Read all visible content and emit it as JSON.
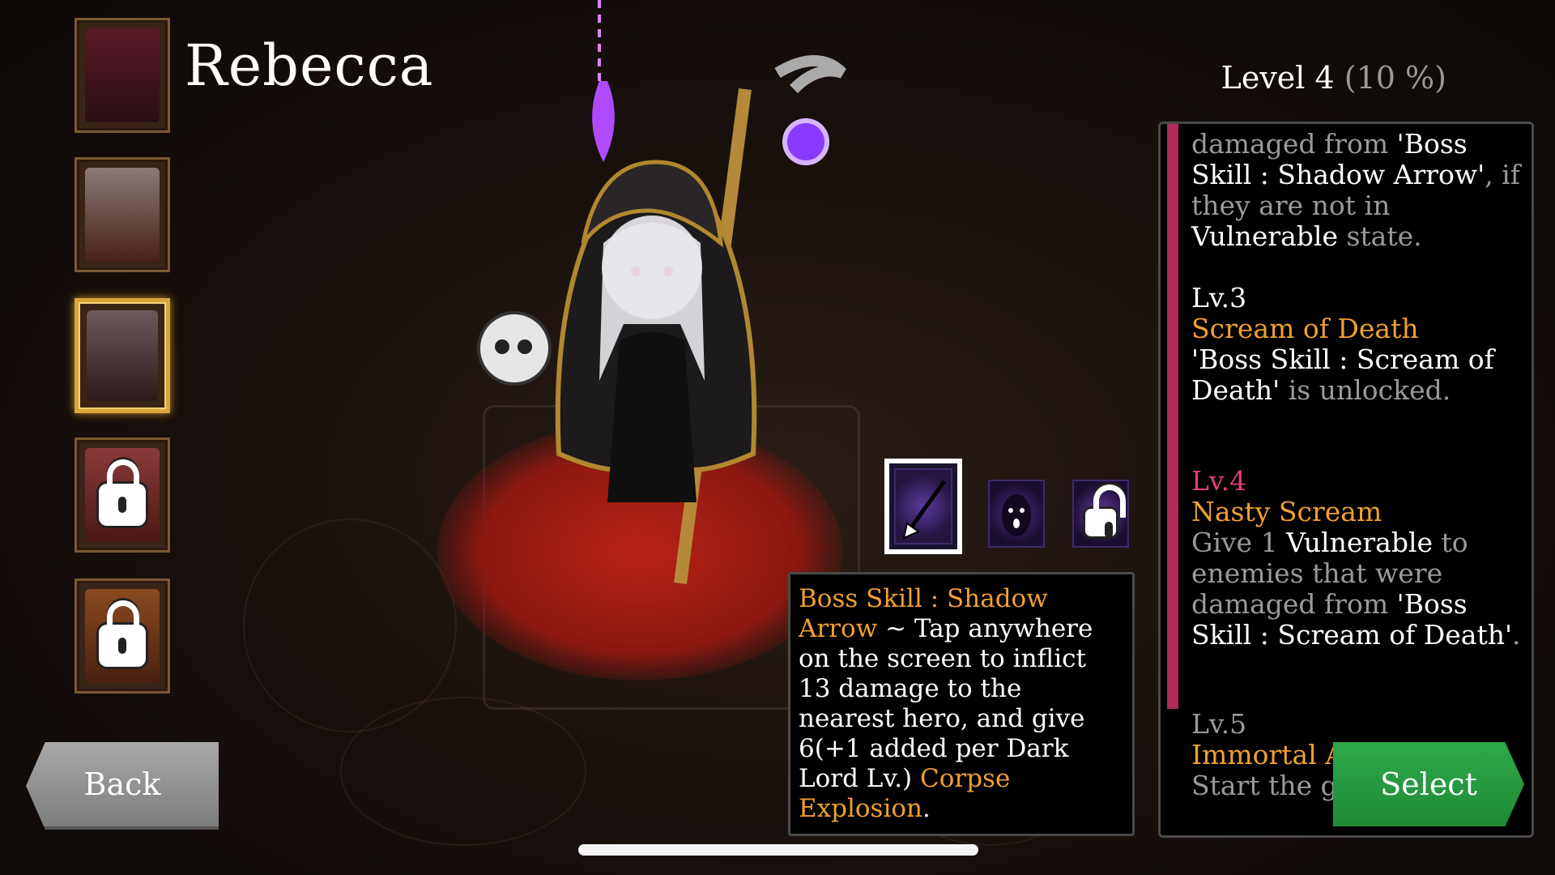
{
  "hero": {
    "name": "Rebecca",
    "level_label": "Level 4",
    "level_progress": "(10 %)"
  },
  "portraits": [
    {
      "id": "portrait-1",
      "locked": false,
      "active": false
    },
    {
      "id": "portrait-2",
      "locked": false,
      "active": false
    },
    {
      "id": "portrait-3",
      "locked": false,
      "active": true
    },
    {
      "id": "portrait-4",
      "locked": true,
      "active": false
    },
    {
      "id": "portrait-5",
      "locked": true,
      "active": false
    }
  ],
  "skills": [
    {
      "icon": "shadow-arrow-icon",
      "selected": true
    },
    {
      "icon": "scream-icon",
      "selected": false
    },
    {
      "icon": "locked-skill-icon",
      "selected": false
    }
  ],
  "tooltip": {
    "skill_name": "Boss Skill : Shadow Arrow",
    "separator": " ~ ",
    "text_1": "Tap anywhere on the screen to inflict 13 damage to the nearest hero, and give 6(+1 added per Dark Lord Lv.) ",
    "keyword": "Corpse Explosion",
    "text_end": "."
  },
  "right_panel": {
    "intro_gray_1": "damaged from ",
    "intro_white_1": "'Boss Skill : Shadow Arrow'",
    "intro_gray_2": ", if they are not in ",
    "intro_white_2": "Vulnerable",
    "intro_gray_3": " state.",
    "lv3_label": "Lv.3",
    "lv3_title": "Scream of Death",
    "lv3_desc_white": "'Boss Skill : Scream of Death'",
    "lv3_desc_gray": " is unlocked.",
    "lv4_label": "Lv.4",
    "lv4_title": "Nasty Scream",
    "lv4_gray_1": "Give 1 ",
    "lv4_white_1": "Vulnerable",
    "lv4_gray_2": " to enemies that were damaged from ",
    "lv4_white_2": "'Boss Skill : Scream of Death'",
    "lv4_gray_3": ".",
    "lv5_label": "Lv.5",
    "lv5_title": "Immortal Aid",
    "lv5_desc": "Start the game in deck."
  },
  "buttons": {
    "back": "Back",
    "select": "Select"
  },
  "colors": {
    "accent_orange": "#f0a030",
    "accent_pink": "#e0407a",
    "select_green": "#2ea84a",
    "back_gray": "#9a9a9a",
    "active_border": "#d9a63c"
  }
}
